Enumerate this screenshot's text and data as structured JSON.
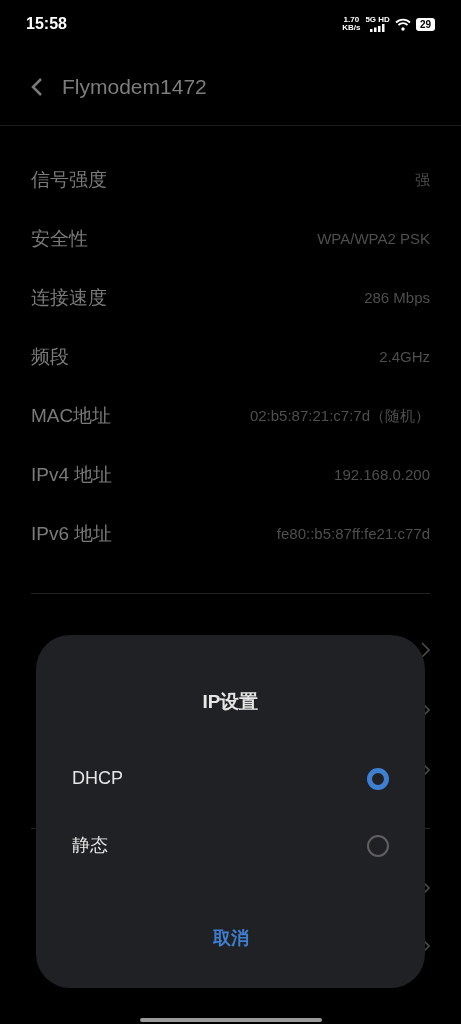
{
  "status_bar": {
    "time": "15:58",
    "speed": "1.70",
    "speed_unit": "KB/s",
    "network": "5G HD",
    "battery": "29"
  },
  "header": {
    "title": "Flymodem1472"
  },
  "details": [
    {
      "label": "信号强度",
      "value": "强"
    },
    {
      "label": "安全性",
      "value": "WPA/WPA2 PSK"
    },
    {
      "label": "连接速度",
      "value": "286 Mbps"
    },
    {
      "label": "频段",
      "value": "2.4GHz"
    },
    {
      "label": "MAC地址",
      "value": "02:b5:87:21:c7:7d（随机）"
    },
    {
      "label": "IPv4 地址",
      "value": "192.168.0.200"
    },
    {
      "label": "IPv6 地址",
      "value": "fe80::b5:87ff:fe21:c77d"
    }
  ],
  "dialog": {
    "title": "IP设置",
    "options": [
      {
        "label": "DHCP",
        "selected": true
      },
      {
        "label": "静态",
        "selected": false
      }
    ],
    "cancel": "取消"
  }
}
